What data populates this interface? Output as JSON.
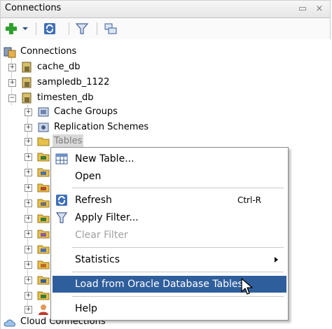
{
  "panel": {
    "title": "Connections",
    "minimize_glyph": "▭",
    "close_glyph": "×"
  },
  "toolbar": {
    "buttons": [
      "add-connection",
      "dropdown",
      "refresh",
      "filter",
      "schema-browser"
    ]
  },
  "tree": {
    "root": "Connections",
    "connections": [
      {
        "label": "cache_db",
        "expanded": false
      },
      {
        "label": "sampledb_1122",
        "expanded": false
      },
      {
        "label": "timesten_db",
        "expanded": true
      }
    ],
    "children": [
      {
        "label": "Cache Groups"
      },
      {
        "label": "Replication Schemes"
      },
      {
        "label": "Tables",
        "selected": true
      }
    ],
    "footer": "Cloud Connections"
  },
  "context_menu": {
    "items": [
      {
        "label": "New Table...",
        "icon": "table-icon"
      },
      {
        "label": "Open"
      },
      {
        "label": "Refresh",
        "shortcut": "Ctrl-R",
        "icon": "refresh-icon"
      },
      {
        "label": "Apply Filter...",
        "icon": "filter-icon"
      },
      {
        "label": "Clear Filter",
        "disabled": true
      },
      {
        "label": "Statistics",
        "submenu": true
      },
      {
        "label": "Load from Oracle Database Tables",
        "highlighted": true
      },
      {
        "label": "Help"
      }
    ]
  },
  "colors": {
    "highlight": "#2f5e9c",
    "add_icon": "#2ea02e",
    "folder": "#e8c04a"
  }
}
